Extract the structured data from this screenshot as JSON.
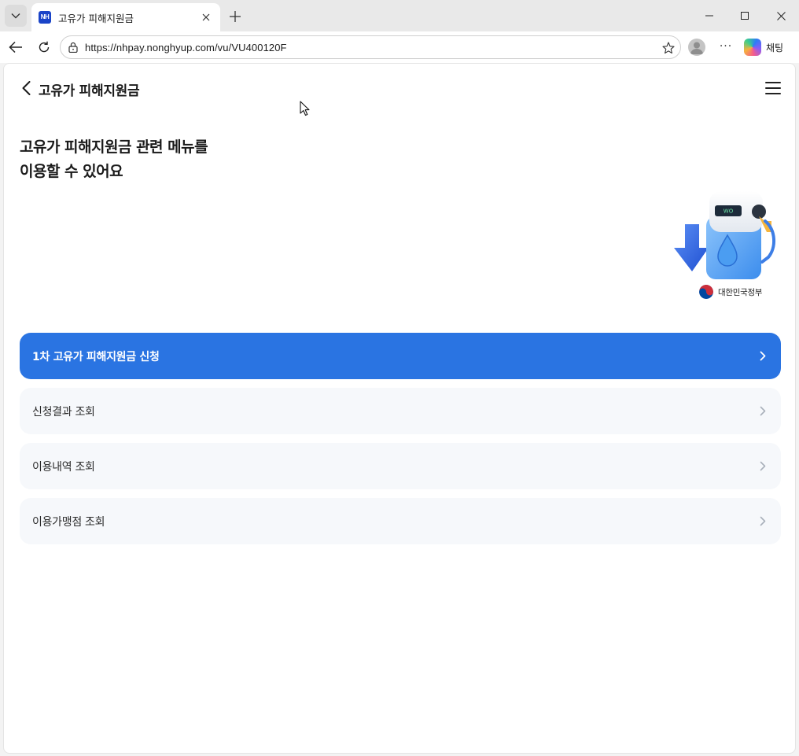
{
  "browser": {
    "tab_title": "고유가 피해지원금",
    "favicon_text": "NH",
    "url": "https://nhpay.nonghyup.com/vu/VU400120F",
    "chat_label": "채팅"
  },
  "header": {
    "title": "고유가 피해지원금"
  },
  "hero": {
    "line1": "고유가 피해지원금 관련 메뉴를",
    "line2": "이용할 수 있어요",
    "pump_display": "WO",
    "gov_label": "대한민국정부"
  },
  "menu": {
    "items": [
      {
        "label": "1차 고유가 피해지원금 신청"
      },
      {
        "label": "신청결과 조회"
      },
      {
        "label": "이용내역 조회"
      },
      {
        "label": "이용가맹점 조회"
      }
    ]
  },
  "colors": {
    "primary": "#2a74e2",
    "item_bg": "#f6f8fb",
    "favicon": "#1a44c8"
  }
}
